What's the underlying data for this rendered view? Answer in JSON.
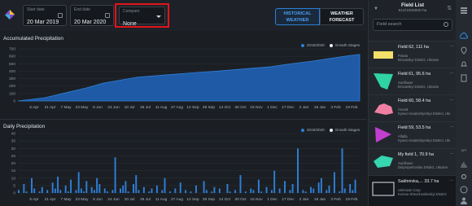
{
  "topbar": {
    "start_date": {
      "label": "Start date",
      "value": "20 Mar 2019"
    },
    "end_date": {
      "label": "End date",
      "value": "20 Mar 2020"
    },
    "compare": {
      "label": "Compare",
      "value": "None"
    },
    "toggle_historical": "HISTORICAL WEATHER",
    "toggle_forecast": "WEATHER FORECAST"
  },
  "accumulated": {
    "title": "Accumulated Precipitation",
    "legend_series": "2019/2020",
    "legend_stages": "Growth Stages",
    "colors": {
      "series": "#2f7fd8",
      "fill": "#1f5aa6"
    }
  },
  "daily": {
    "title": "Daily Precipitation",
    "legend_series": "2019/2020",
    "legend_stages": "Growth Stages"
  },
  "chart_data": [
    {
      "type": "area",
      "title": "Accumulated Precipitation",
      "x_ticks": [
        "5 Apr",
        "21 Apr",
        "7 May",
        "23 May",
        "8 Jun",
        "24 Jun",
        "10 Jul",
        "26 Jul",
        "11 Aug",
        "27 Aug",
        "12 Sep",
        "28 Sep",
        "14 Oct",
        "30 Oct",
        "15 Nov",
        "1 Dec",
        "17 Dec",
        "2 Jan",
        "18 Jan",
        "3 Feb",
        "19 Feb"
      ],
      "y_ticks": [
        0,
        100,
        200,
        300,
        400,
        500,
        600,
        700
      ],
      "ylim": [
        0,
        700
      ],
      "series": [
        {
          "name": "2019/2020",
          "x_frac": [
            0,
            0.08,
            0.14,
            0.2,
            0.25,
            0.3,
            0.35,
            0.42,
            0.5,
            0.58,
            0.66,
            0.74,
            0.8,
            0.86,
            0.92,
            0.97,
            1.0
          ],
          "values": [
            0,
            45,
            110,
            175,
            240,
            280,
            320,
            345,
            375,
            400,
            430,
            460,
            500,
            535,
            575,
            610,
            625
          ]
        }
      ]
    },
    {
      "type": "bar",
      "title": "Daily Precipitation",
      "x_ticks": [
        "5 Apr",
        "21 Apr",
        "7 May",
        "23 May",
        "8 Jun",
        "24 Jun",
        "10 Jul",
        "26 Jul",
        "11 Aug",
        "27 Aug",
        "12 Sep",
        "28 Sep",
        "14 Oct",
        "30 Oct",
        "15 Nov",
        "1 Dec",
        "17 Dec",
        "2 Jan",
        "18 Jan",
        "3 Feb",
        "19 Feb"
      ],
      "y_ticks": [
        0,
        5,
        10,
        15,
        20,
        25,
        30,
        35,
        40
      ],
      "ylim": [
        0,
        40
      ],
      "series": [
        {
          "name": "2019/2020",
          "values": [
            2,
            0,
            6,
            1,
            0,
            10,
            3,
            0,
            1,
            4,
            0,
            2,
            0,
            7,
            3,
            11,
            2,
            0,
            5,
            1,
            9,
            0,
            2,
            14,
            3,
            1,
            8,
            0,
            4,
            2,
            10,
            6,
            0,
            3,
            1,
            0,
            2,
            24,
            0,
            3,
            5,
            8,
            1,
            0,
            6,
            12,
            2,
            0,
            4,
            0,
            1,
            3,
            0,
            5,
            0,
            2,
            10,
            0,
            1,
            0,
            3,
            0,
            7,
            0,
            2,
            0,
            1,
            0,
            5,
            0,
            0,
            8,
            2,
            0,
            1,
            4,
            0,
            3,
            0,
            0,
            6,
            1,
            0,
            2,
            0,
            12,
            0,
            1,
            0,
            3,
            2,
            0,
            9,
            1,
            0,
            4,
            0,
            2,
            15,
            0,
            3,
            0,
            8,
            0,
            2,
            6,
            0,
            30,
            0,
            2,
            1,
            0,
            4,
            3,
            0,
            7,
            10,
            0,
            2,
            5,
            0,
            14,
            0,
            1,
            30,
            3,
            0,
            6,
            2,
            9,
            0
          ]
        }
      ]
    }
  ],
  "fieldlist": {
    "title": "Field List",
    "count": "912/1000000 ha",
    "search_placeholder": "Field search",
    "items": [
      {
        "name": "Field 62, 111 ha",
        "crop": "Potato",
        "location": "Brovarskyi District, Ukraine"
      },
      {
        "name": "Field 61, 95.6 ha",
        "crop": "Sunflower",
        "location": "Brovarskyi District, Ukraine"
      },
      {
        "name": "Field 60, 58.4 ha",
        "crop": "Cereal",
        "location": "Kyievo-Sviatoshynskyi District, Ukraine"
      },
      {
        "name": "Field 59, 53.5 ha",
        "crop": "Alfalfa",
        "location": "Kyievo-Sviatoshynskyi District, Ukraine"
      },
      {
        "name": "My field 1, 70.9 ha",
        "crop": "Sunflower",
        "location": "Dnipropetrovska District, Ukraine"
      },
      {
        "name": "Sakhnivka,... 33.7 ha",
        "crop": "Unknown Crop",
        "location": "Korsun-Shevchenkivskyi District"
      }
    ]
  },
  "rail": {
    "bottom_label": "API"
  }
}
